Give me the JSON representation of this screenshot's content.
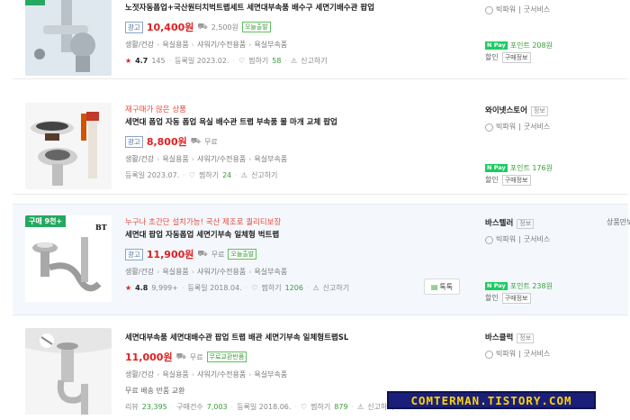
{
  "products": [
    {
      "promo": "",
      "title": "노젓자동폽업+국산원터치벅트랩세트 세면대부속품 배수구 세면기배수관 팝업",
      "ad_label": "광고",
      "price": "10,400원",
      "shipping": "2,500원",
      "tag": "오늘출발",
      "categories": [
        "생활/건강",
        "욕실용품",
        "샤워기/수전용품",
        "욕실부속품"
      ],
      "rating": "4.7",
      "review_count": "145",
      "registered": "등록일 2023.02.",
      "favorites_label": "찜하기",
      "favorites": "58",
      "report": "신고하기",
      "extra": "",
      "store": "",
      "store_grade": "",
      "badges": [
        "빅파워",
        "굿서비스"
      ],
      "npay": "N Pay",
      "points": "포인트 208원",
      "bottom_left": "할인",
      "bottom_btn": "구매정보",
      "flag": "",
      "talk": "",
      "more": ""
    },
    {
      "promo": "재구매가 많은 상품",
      "title": "세면대 폽업 자동 폽업 욕실 배수관 트랩 부속품 물 마개 교체 팝업",
      "ad_label": "광고",
      "price": "8,800원",
      "shipping": "무료",
      "tag": "",
      "categories": [
        "생활/건강",
        "욕실용품",
        "샤워기/수전용품",
        "욕실부속품"
      ],
      "rating": "",
      "review_count": "",
      "registered": "등록일 2023.07.",
      "favorites_label": "찜하기",
      "favorites": "24",
      "report": "신고하기",
      "extra": "",
      "store": "와이넷스토어",
      "store_grade": "정보",
      "badges": [
        "빅파워",
        "굿서비스"
      ],
      "npay": "N Pay",
      "points": "포인트 176원",
      "bottom_left": "할인",
      "bottom_btn": "구매정보",
      "flag": "",
      "talk": "",
      "more": ""
    },
    {
      "promo": "누구나 초간단 설치가능! 국산 제조로 퀄리티보장",
      "title": "세면대 팝업 자동폽업 세면기부속 일체형 벅트랩",
      "ad_label": "광고",
      "price": "11,900원",
      "shipping": "무료",
      "tag": "오늘출발",
      "categories": [
        "생활/건강",
        "욕실용품",
        "샤워기/수전용품",
        "욕실부속품"
      ],
      "rating": "4.8",
      "review_count": "9,999+",
      "registered": "등록일 2018.04.",
      "favorites_label": "찜하기",
      "favorites": "1206",
      "report": "신고하기",
      "extra": "",
      "store": "바스텔러",
      "store_grade": "정보",
      "badges": [
        "빅파워",
        "굿서비스"
      ],
      "npay": "N Pay",
      "points": "포인트 238원",
      "bottom_left": "할인",
      "bottom_btn": "구매정보",
      "flag": "구매 9천+",
      "talk": "톡톡",
      "more": "상품만보기"
    },
    {
      "promo": "",
      "title": "세면대부속품 세면대배수관 팝업 트랩 배관 세면기부속 일체형트랩SL",
      "ad_label": "",
      "price": "11,000원",
      "shipping": "무료",
      "tag": "무료교환반품",
      "categories": [
        "생활/건강",
        "욕실용품",
        "샤워기/수전용품",
        "욕실부속품"
      ],
      "rating": "",
      "review_count": "",
      "registered": "등록일 2018.06.",
      "favorites_label": "찜하기",
      "favorites": "879",
      "report": "신고하기",
      "review_label": "리뷰",
      "review_total": "23,395",
      "purchase_label": "구매건수",
      "purchase_count": "7,003",
      "extra": "무료 배송 반품 교환",
      "store": "바스클럭",
      "store_grade": "정보",
      "badges": [
        "빅파워",
        "굿서비스"
      ],
      "npay": "",
      "points": "",
      "bottom_left": "할인",
      "bottom_btn": "구매정보",
      "flag": "",
      "talk": "",
      "more": ""
    }
  ],
  "watermark": "COMTERMAN.TISTORY.COM",
  "colors": {
    "price": "#e02020",
    "accent_green": "#3a9c3a",
    "npay": "#19ce60",
    "ad_bg": "#f4f8fd"
  }
}
